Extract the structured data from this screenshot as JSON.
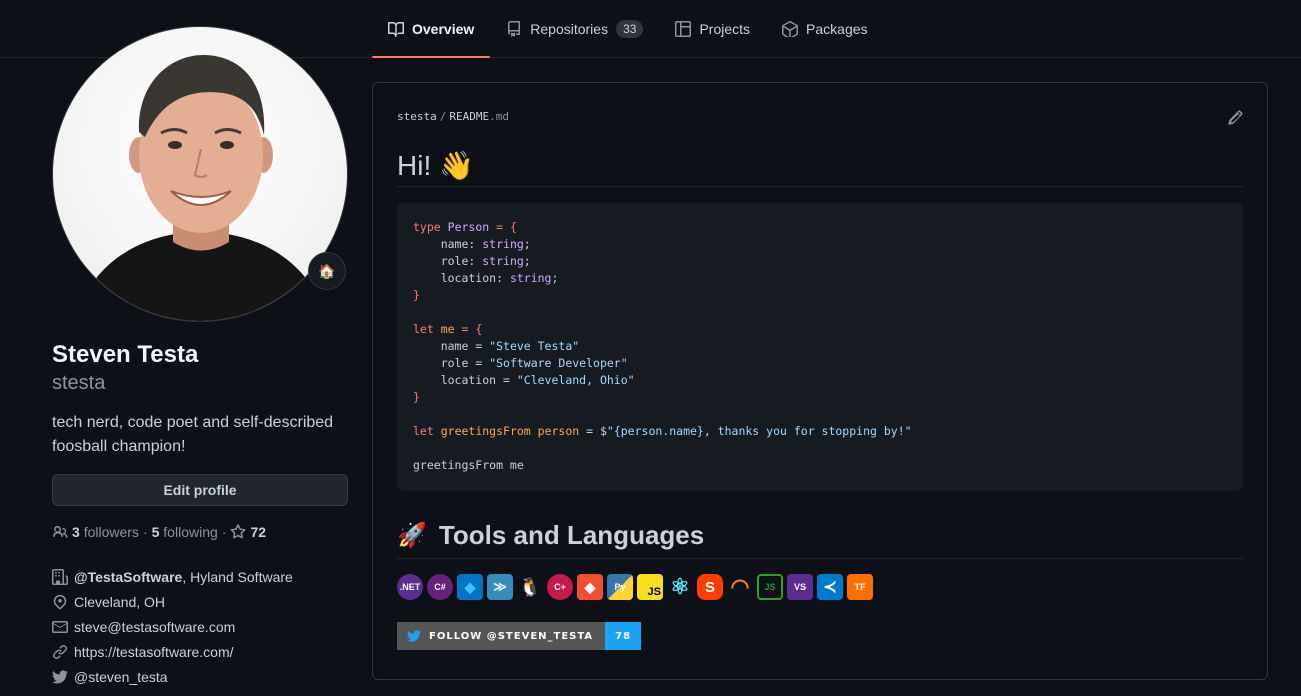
{
  "nav": {
    "tabs": [
      {
        "label": "Overview",
        "icon": "book-icon",
        "active": true
      },
      {
        "label": "Repositories",
        "icon": "repo-icon",
        "count": "33"
      },
      {
        "label": "Projects",
        "icon": "project-icon"
      },
      {
        "label": "Packages",
        "icon": "package-icon"
      }
    ]
  },
  "profile": {
    "name": "Steven Testa",
    "username": "stesta",
    "bio": "tech nerd, code poet and self-described foosball champion!",
    "status_emoji": "🏠",
    "edit_label": "Edit profile",
    "followers_count": "3",
    "followers_label": "followers",
    "following_count": "5",
    "following_label": "following",
    "stars_count": "72",
    "org_handle": "@TestaSoftware",
    "org_rest": ", Hyland Software",
    "location": "Cleveland, OH",
    "email": "steve@testasoftware.com",
    "website": "https://testasoftware.com/",
    "twitter": "@steven_testa"
  },
  "readme": {
    "owner": "stesta",
    "slash": "/",
    "file_name": "README",
    "file_ext": ".md",
    "heading": "Hi!",
    "heading_emoji": "👋",
    "code": {
      "l1_kw": "type",
      "l1_name": "Person",
      "l1_rest": " = {",
      "l2_key": "    name: ",
      "l2_type": "string",
      "l3_key": "    role: ",
      "l3_type": "string",
      "l4_key": "    location: ",
      "l4_type": "string",
      "semi": ";",
      "close": "}",
      "l6_kw": "let",
      "l6_name": "me",
      "l6_rest": " = {",
      "l7_key": "    name = ",
      "l7_val": "\"Steve Testa\"",
      "l8_key": "    role = ",
      "l8_val": "\"Software Developer\"",
      "l9_key": "    location = ",
      "l9_val": "\"Cleveland, Ohio\"",
      "l11_kw": "let",
      "l11_name": "greetingsFrom person",
      "l11_eq": " = $",
      "l11_str": "\"{person.name}, thanks you for stopping by!\"",
      "l13": "greetingsFrom me"
    },
    "tools_heading": "Tools and Languages",
    "tools_emoji": "🚀",
    "tools": [
      {
        "name": "dotnet-icon",
        "label": ".NET",
        "color": "#5c2d91"
      },
      {
        "name": "csharp-icon",
        "label": "C#",
        "color": "#68217a"
      },
      {
        "name": "dart-icon",
        "label": "◆",
        "color": "#0175c2"
      },
      {
        "name": "fsharp-icon",
        "label": "≫",
        "color": "#378bba"
      },
      {
        "name": "linux-icon",
        "label": "🐧",
        "color": "#0d1117"
      },
      {
        "name": "cplusplus-icon",
        "label": "C+",
        "color": "#c51a4a"
      },
      {
        "name": "git-icon",
        "label": "◆",
        "color": "#f05032"
      },
      {
        "name": "python-icon",
        "label": "Py",
        "color": "#3776ab"
      },
      {
        "name": "javascript-icon",
        "label": "JS",
        "color": "#f7df1e"
      },
      {
        "name": "react-icon",
        "label": "⚛",
        "color": "#0d1117"
      },
      {
        "name": "svelte-icon",
        "label": "S",
        "color": "#ff3e00"
      },
      {
        "name": "jupyter-icon",
        "label": "◠",
        "color": "#0d1117"
      },
      {
        "name": "nodejs-icon",
        "label": "JS",
        "color": "#339933"
      },
      {
        "name": "visualstudio-icon",
        "label": "VS",
        "color": "#5c2d91"
      },
      {
        "name": "vscode-icon",
        "label": "≺",
        "color": "#007acc"
      },
      {
        "name": "tensorflow-icon",
        "label": "TF",
        "color": "#ff6f00"
      }
    ],
    "twitter_badge_label": "FOLLOW @STEVEN_TESTA",
    "twitter_badge_count": "78"
  },
  "colors": {
    "background": "#0d1117",
    "accent_tab": "#f78166",
    "twitter_blue": "#1da1f2"
  }
}
